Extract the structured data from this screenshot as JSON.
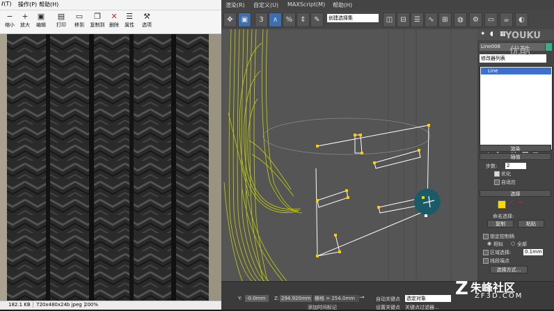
{
  "viewer": {
    "menu": [
      "ℓ(T)",
      "操作(P)",
      "帮助(H)"
    ],
    "toolbar": [
      {
        "label": "缩小",
        "icon": "zoom-out-icon",
        "glyph": "🔍"
      },
      {
        "label": "放大",
        "icon": "zoom-in-icon",
        "glyph": "🔍"
      },
      {
        "label": "编辑",
        "icon": "save-icon",
        "glyph": "💾"
      },
      {
        "label": "打印",
        "icon": "print-icon",
        "glyph": "🖶"
      },
      {
        "label": "移到",
        "icon": "move-to-icon",
        "glyph": "📁"
      },
      {
        "label": "复制到",
        "icon": "copy-to-icon",
        "glyph": "📂"
      },
      {
        "label": "删除",
        "icon": "delete-icon",
        "glyph": "✕"
      },
      {
        "label": "属性",
        "icon": "properties-icon",
        "glyph": "▤"
      },
      {
        "label": "选项",
        "icon": "options-icon",
        "glyph": "⚒"
      }
    ],
    "status": {
      "size": "182.1 KB",
      "info": "720x480x24b jpeg",
      "zoom": "200%"
    }
  },
  "max": {
    "menu": [
      "渲染(R)",
      "自定义(U)",
      "MAXScript(M)",
      "帮助(H)"
    ],
    "selection_set_placeholder": "创建选择集",
    "command_panel": {
      "object_name": "Line008",
      "modifier_list": "修改器列表",
      "stack_item": "Line",
      "rendering_header": "渲染",
      "interpolation_header": "插值",
      "steps_label": "步数:",
      "steps_value": "2",
      "optimize_label": "优化",
      "adaptive_label": "自适应",
      "selection_header": "选择",
      "named_selection_label": "命名选择:",
      "copy_button": "复制",
      "paste_button": "粘贴",
      "lock_handles_label": "锁定控制柄",
      "similar_label": "相似",
      "all_label": "全部",
      "area_selection_label": "区域选择:",
      "area_value": "0.1mm",
      "segment_end_label": "线段端点",
      "select_by_button": "选择方式..."
    },
    "bottom": {
      "y_label": "Y:",
      "y_value": "-0.0mm",
      "z_label": "Z:",
      "z_value": "294.920mm",
      "grid_text": "栅格 = 254.0mm",
      "auto_key": "自动关键点",
      "selected_object": "选定对象",
      "set_key": "设置关键点",
      "key_filter": "关键点过滤器...",
      "add_time_tag": "添加时间标记"
    },
    "highlight_color": "#1b5b67",
    "wireframe_color": "#c8d400",
    "spline_color": "#ffffff",
    "vertex_color": "#ffcc00"
  },
  "watermark_youku": {
    "logo": "YOUKU",
    "cn": "优酷"
  },
  "watermark_zf": {
    "cn": "朱峰社区",
    "url": "ZF3D.COM"
  }
}
